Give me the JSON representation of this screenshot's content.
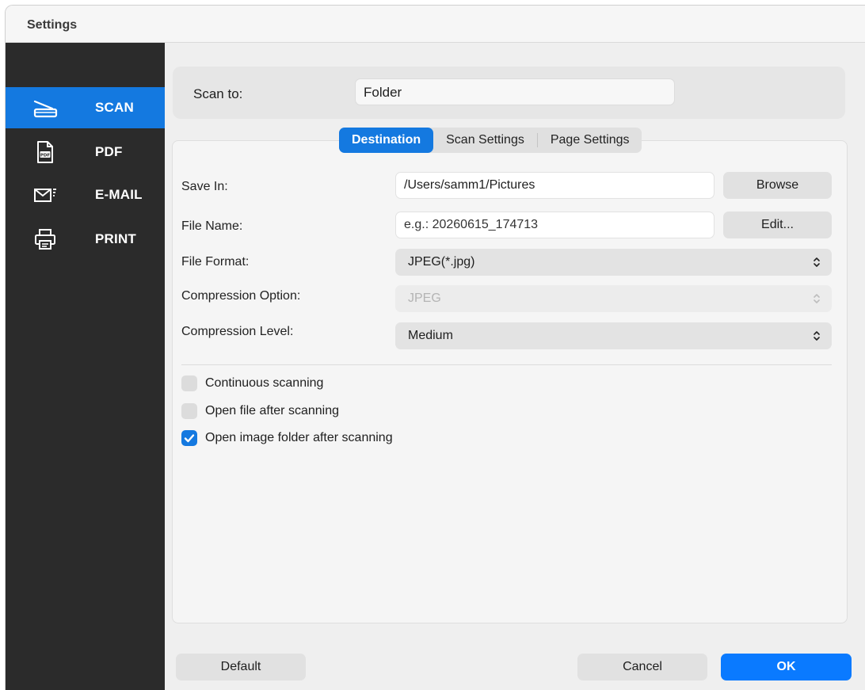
{
  "window": {
    "title": "Settings"
  },
  "sidebar": {
    "items": [
      {
        "label": "SCAN",
        "icon": "scanner-icon",
        "active": true
      },
      {
        "label": "PDF",
        "icon": "pdf-file-icon",
        "active": false
      },
      {
        "label": "E-MAIL",
        "icon": "envelope-icon",
        "active": false
      },
      {
        "label": "PRINT",
        "icon": "printer-icon",
        "active": false
      }
    ]
  },
  "scan_to": {
    "label": "Scan to:",
    "value": "Folder"
  },
  "tabs": [
    {
      "label": "Destination",
      "active": true
    },
    {
      "label": "Scan Settings",
      "active": false
    },
    {
      "label": "Page Settings",
      "active": false
    }
  ],
  "destination": {
    "save_in": {
      "label": "Save In:",
      "value": "/Users/samm1/Pictures",
      "button": "Browse"
    },
    "file_name": {
      "label": "File Name:",
      "value": "e.g.: 20260615_174713",
      "button": "Edit..."
    },
    "file_format": {
      "label": "File Format:",
      "value": "JPEG(*.jpg)"
    },
    "compression_option": {
      "label": "Compression Option:",
      "value": "JPEG",
      "disabled": true
    },
    "compression_level": {
      "label": "Compression Level:",
      "value": "Medium"
    },
    "options": [
      {
        "label": "Continuous scanning",
        "checked": false
      },
      {
        "label": "Open file after scanning",
        "checked": false
      },
      {
        "label": "Open image folder after scanning",
        "checked": true
      }
    ]
  },
  "footer": {
    "default": "Default",
    "cancel": "Cancel",
    "ok": "OK"
  },
  "colors": {
    "accent": "#1479e0",
    "sidebar_bg": "#2b2b2b",
    "ok_button": "#0a7aff"
  }
}
